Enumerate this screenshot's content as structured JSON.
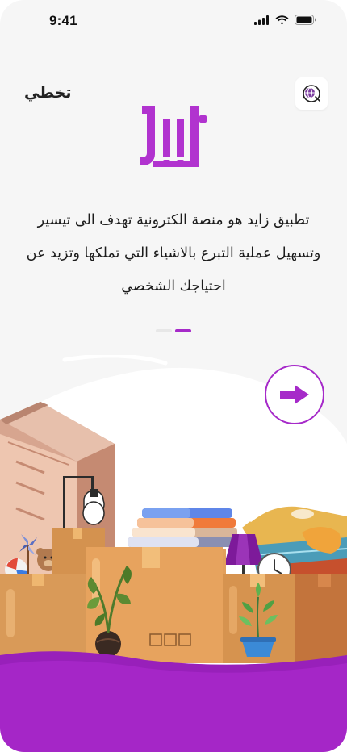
{
  "status_bar": {
    "time": "9:41"
  },
  "top": {
    "skip_label": "تخطي"
  },
  "onboarding": {
    "description": "تطبيق زايد هو منصة الكترونية تهدف الى تيسير وتسهيل عملية التبرع بالاشياء التي تملكها وتزيد عن احتياجك الشخصي",
    "page_index": 2,
    "page_count": 2
  },
  "colors": {
    "brand": "#a62ac9",
    "brand_light": "#b64dd3",
    "background": "#f6f6f6"
  },
  "icons": [
    "cellular-icon",
    "wifi-icon",
    "battery-icon",
    "language-icon",
    "arrow-right-icon"
  ]
}
